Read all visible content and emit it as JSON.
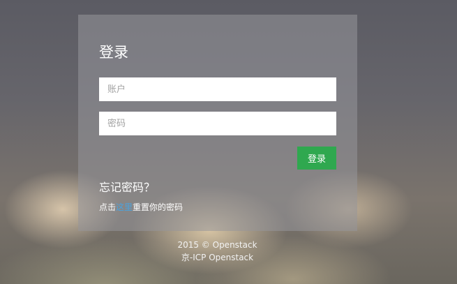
{
  "login": {
    "title": "登录",
    "account_placeholder": "账户",
    "password_placeholder": "密码",
    "submit_label": "登录"
  },
  "forgot": {
    "title": "忘记密码？",
    "prefix": "点击",
    "link": "这里",
    "suffix": "重置你的密码"
  },
  "footer": {
    "copyright": "2015 © Openstack",
    "icp": "京-ICP Openstack"
  },
  "colors": {
    "primary_button": "#2fa84f",
    "link": "#4aa3df"
  }
}
